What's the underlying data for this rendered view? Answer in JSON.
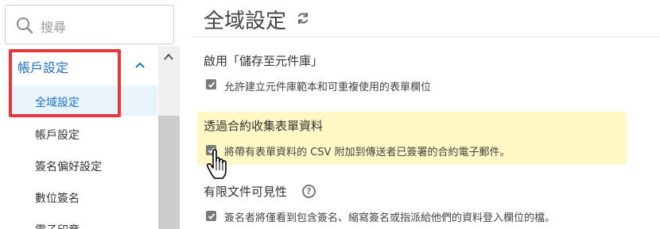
{
  "sidebar": {
    "search": {
      "placeholder": "搜尋",
      "icon": "search-icon"
    },
    "section": {
      "label": "帳戶設定",
      "icon": "chevron-up-icon"
    },
    "items": [
      {
        "label": "全域設定",
        "active": true
      },
      {
        "label": "帳戶設定"
      },
      {
        "label": "簽名偏好設定"
      },
      {
        "label": "數位簽名"
      },
      {
        "label": "電子印章"
      }
    ]
  },
  "main": {
    "title": "全域設定",
    "title_icon": "refresh-icon",
    "sections": [
      {
        "title": "啟用「儲存至元件庫」",
        "option": "允許建立元件庫範本和可重複使用的表單欄位",
        "checked": true
      },
      {
        "title": "透過合約收集表單資料",
        "option": "將帶有表單資料的 CSV 附加到傳送者已簽署的合約電子郵件。",
        "checked": true,
        "highlighted": true
      },
      {
        "title": "有限文件可見性",
        "title_icon": "help-icon",
        "option": "簽名者將僅看到包含簽名、縮寫簽名或指派給他們的資料登入欄位的檔。",
        "checked": true
      }
    ],
    "help_glyph": "?"
  },
  "colors": {
    "accent": "#1a73c8",
    "highlight_box": "#e8363b",
    "highlight_bg": "#fdf8c4"
  }
}
